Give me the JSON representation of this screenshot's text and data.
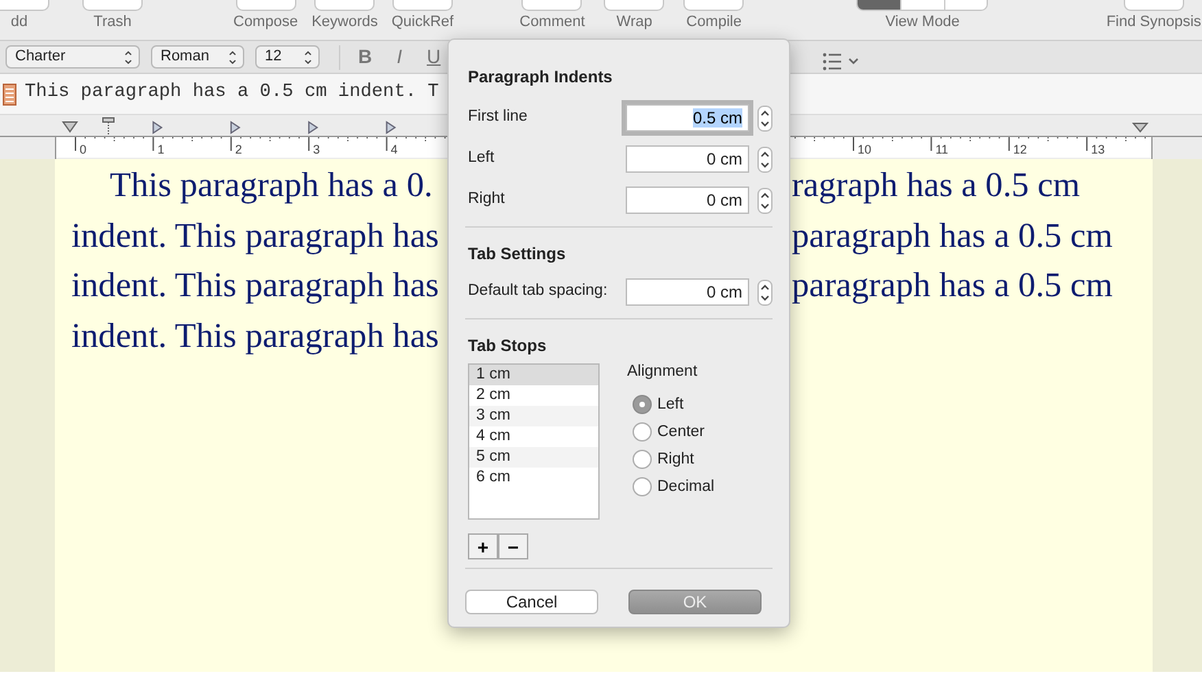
{
  "toolbar": {
    "groups": [
      [
        {
          "label": "dd",
          "kind": "button"
        },
        {
          "label": "Trash",
          "kind": "button"
        }
      ],
      [
        {
          "label": "Compose",
          "kind": "button"
        },
        {
          "label": "Keywords",
          "kind": "button"
        },
        {
          "label": "QuickRef",
          "kind": "button"
        }
      ],
      [
        {
          "label": "Comment",
          "kind": "button"
        },
        {
          "label": "Wrap",
          "kind": "button"
        },
        {
          "label": "Compile",
          "kind": "button"
        }
      ],
      [
        {
          "label": "View Mode",
          "kind": "segmented"
        }
      ],
      [
        {
          "label": "Find Synopsis",
          "kind": "button"
        }
      ]
    ]
  },
  "format_bar": {
    "font": "Charter",
    "style": "Roman",
    "size": "12",
    "styles": [
      "B",
      "I",
      "U"
    ]
  },
  "title_bar": {
    "text": "This paragraph has a 0.5 cm indent. T"
  },
  "ruler": {
    "left_numbers": [
      "0",
      "1",
      "2",
      "3",
      "4"
    ],
    "right_numbers": [
      "10",
      "11",
      "12",
      "13"
    ]
  },
  "document": {
    "lines": [
      {
        "left": "This paragraph has a 0.",
        "right": "ragraph has a 0.5 cm",
        "first": true
      },
      {
        "left": "indent. This paragraph has",
        "right": "paragraph has a 0.5 cm",
        "first": false
      },
      {
        "left": "indent. This paragraph has",
        "right": "paragraph has a 0.5 cm",
        "first": false
      },
      {
        "left": "indent. This paragraph has",
        "first": false
      }
    ]
  },
  "popover": {
    "indents": {
      "title": "Paragraph Indents",
      "fields": [
        {
          "label": "First line",
          "value": "0.5 cm",
          "focused": true
        },
        {
          "label": "Left",
          "value": "0 cm",
          "focused": false
        },
        {
          "label": "Right",
          "value": "0 cm",
          "focused": false
        }
      ]
    },
    "tab_settings": {
      "title": "Tab Settings",
      "fields": [
        {
          "label": "Default tab spacing:",
          "value": "0 cm",
          "focused": false
        }
      ]
    },
    "tab_stops": {
      "title": "Tab Stops",
      "items": [
        {
          "label": "1 cm",
          "selected": true
        },
        {
          "label": "2 cm",
          "selected": false
        },
        {
          "label": "3 cm",
          "selected": false
        },
        {
          "label": "4 cm",
          "selected": false
        },
        {
          "label": "5 cm",
          "selected": false
        },
        {
          "label": "6 cm",
          "selected": false
        }
      ],
      "add": "+",
      "remove": "−",
      "alignment_title": "Alignment",
      "alignments": [
        {
          "label": "Left",
          "selected": true
        },
        {
          "label": "Center",
          "selected": false
        },
        {
          "label": "Right",
          "selected": false
        },
        {
          "label": "Decimal",
          "selected": false
        }
      ]
    },
    "buttons": [
      {
        "label": "Cancel",
        "kind": "cancel"
      },
      {
        "label": "OK",
        "kind": "ok"
      }
    ]
  }
}
